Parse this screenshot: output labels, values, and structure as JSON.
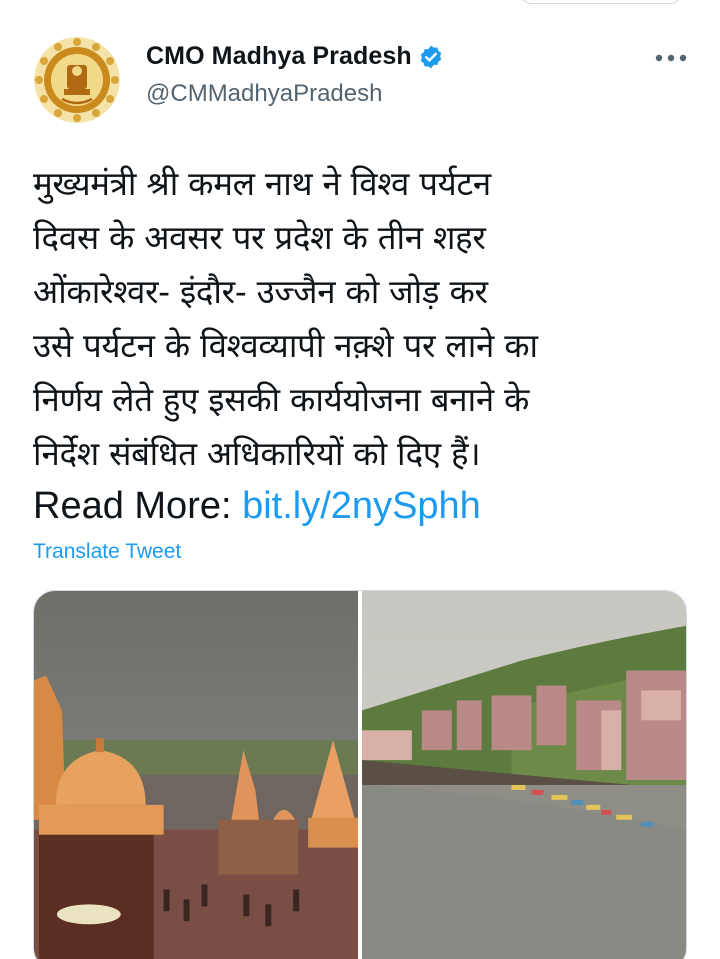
{
  "account": {
    "name": "CMO Madhya Pradesh",
    "handle": "@CMMadhyaPradesh",
    "verified": true,
    "avatar_icon": "madhya-pradesh-emblem-icon",
    "accent_color": "#1d9bf0"
  },
  "tweet": {
    "text_lines": [
      "मुख्यमंत्री श्री कमल नाथ ने विश्व पर्यटन",
      "दिवस के अवसर पर प्रदेश के तीन शहर",
      "ओंकारेश्वर- इंदौर- उज्जैन को जोड़ कर",
      "उसे पर्यटन के विश्वव्यापी नक़्शे पर लाने का",
      "निर्णय लेते हुए इसकी कार्ययोजना बनाने के",
      "निर्देश संबंधित अधिकारियों को दिए हैं।"
    ],
    "read_more_label": "Read More:",
    "link_text": "bit.ly/2nySphh",
    "translate_label": "Translate Tweet"
  },
  "actions": {
    "more_icon": "more-options-icon"
  },
  "media": {
    "photos": [
      {
        "icon": "temple-ghat-photo"
      },
      {
        "icon": "river-town-photo"
      }
    ]
  }
}
